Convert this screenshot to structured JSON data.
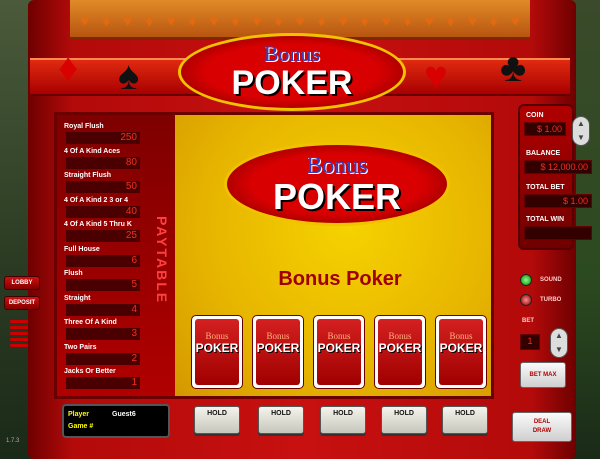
{
  "header": {
    "logo_line1": "Bonus",
    "logo_line2": "POKER",
    "suits": [
      "♦",
      "♠",
      "♥",
      "♣"
    ]
  },
  "screen": {
    "logo_line1": "Bonus",
    "logo_line2": "POKER",
    "game_title": "Bonus Poker",
    "paytable_label": "PAYTABLE"
  },
  "paytable": [
    {
      "hand": "Royal Flush",
      "payout": "250"
    },
    {
      "hand": "4 Of A Kind Aces",
      "payout": "80"
    },
    {
      "hand": "Straight Flush",
      "payout": "50"
    },
    {
      "hand": "4 Of A Kind 2 3 or 4",
      "payout": "40"
    },
    {
      "hand": "4 Of A Kind 5 Thru K",
      "payout": "25"
    },
    {
      "hand": "Full House",
      "payout": "6"
    },
    {
      "hand": "Flush",
      "payout": "5"
    },
    {
      "hand": "Straight",
      "payout": "4"
    },
    {
      "hand": "Three Of A Kind",
      "payout": "3"
    },
    {
      "hand": "Two Pairs",
      "payout": "2"
    },
    {
      "hand": "Jacks Or Better",
      "payout": "1"
    }
  ],
  "cards": [
    {
      "line1": "Bonus",
      "line2": "POKER"
    },
    {
      "line1": "Bonus",
      "line2": "POKER"
    },
    {
      "line1": "Bonus",
      "line2": "POKER"
    },
    {
      "line1": "Bonus",
      "line2": "POKER"
    },
    {
      "line1": "Bonus",
      "line2": "POKER"
    }
  ],
  "hold_label": "HOLD",
  "player": {
    "player_label": "Player",
    "player_name": "Guest6",
    "game_label": "Game #",
    "game_value": ""
  },
  "side": {
    "coin_label": "COIN",
    "coin_value": "$ 1.00",
    "balance_label": "BALANCE",
    "balance_value": "$ 12,000.00",
    "total_bet_label": "TOTAL BET",
    "total_bet_value": "$ 1.00",
    "total_win_label": "TOTAL WIN",
    "total_win_value": ""
  },
  "controls": {
    "lobby": "LOBBY",
    "deposit": "DEPOSIT",
    "sound": "SOUND",
    "turbo": "TURBO",
    "bet_label": "BET",
    "bet_value": "1",
    "bet_max": "BET MAX",
    "deal_draw_1": "DEAL",
    "deal_draw_2": "DRAW",
    "up_arrow": "▲",
    "down_arrow": "▼"
  },
  "version": "1.7.3",
  "colors": {
    "accent_red": "#c81010",
    "screen_yellow": "#e8b000",
    "logo_gold": "#f2c200"
  }
}
